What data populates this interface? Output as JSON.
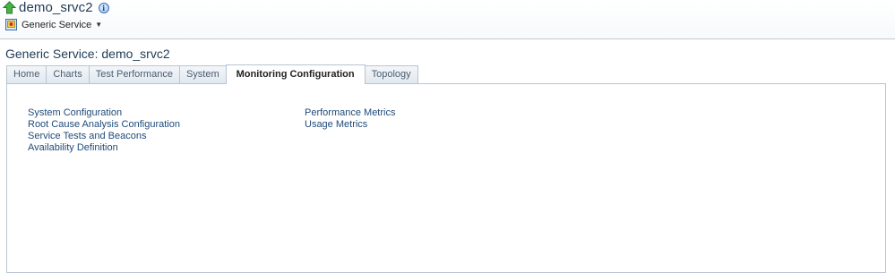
{
  "header": {
    "target_name": "demo_srvc2",
    "menu_label": "Generic Service",
    "icons": {
      "up": "target-up-arrow-icon",
      "info": "info-icon",
      "service": "generic-service-icon",
      "caret": "dropdown-caret-icon"
    }
  },
  "page": {
    "title": "Generic Service: demo_srvc2"
  },
  "tabs": [
    {
      "label": "Home",
      "active": false
    },
    {
      "label": "Charts",
      "active": false
    },
    {
      "label": "Test Performance",
      "active": false
    },
    {
      "label": "System",
      "active": false
    },
    {
      "label": "Monitoring Configuration",
      "active": true
    },
    {
      "label": "Topology",
      "active": false
    }
  ],
  "links": {
    "column1": [
      "System Configuration",
      "Root Cause Analysis Configuration",
      "Service Tests and Beacons",
      "Availability Definition"
    ],
    "column2": [
      "Performance Metrics",
      "Usage Metrics"
    ]
  },
  "colors": {
    "title": "#1f3b57",
    "link": "#1f4a7a",
    "tab_border": "#b9c5d1",
    "up_arrow": "#3da33a"
  }
}
